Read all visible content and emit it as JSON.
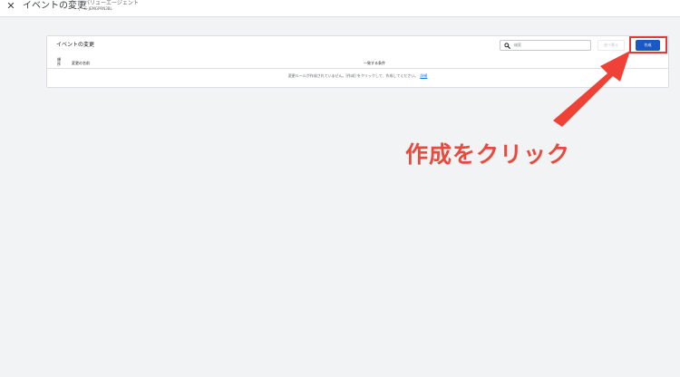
{
  "header": {
    "close_icon": "close-icon",
    "title": "イベントの変更",
    "property_name": "バリューエージェント",
    "property_id": "G-JEMGPRN3BL"
  },
  "card": {
    "title": "イベントの変更",
    "search": {
      "placeholder": "検索",
      "icon": "search-icon"
    },
    "reorder_label": "並べ替え",
    "create_label": "作成",
    "columns": {
      "order": "順序",
      "name": "変更の名前",
      "conditions": "一致する条件"
    },
    "empty_message": "変更ルールが作成されていません。[作成] をクリックして、作成してください。",
    "details_link": "詳細"
  },
  "annotation": {
    "callout_text": "作成をクリック",
    "color": "#e84a3d"
  },
  "colors": {
    "primary": "#1a57c7",
    "background": "#f1f3f4",
    "annotation_red": "#e53935"
  }
}
